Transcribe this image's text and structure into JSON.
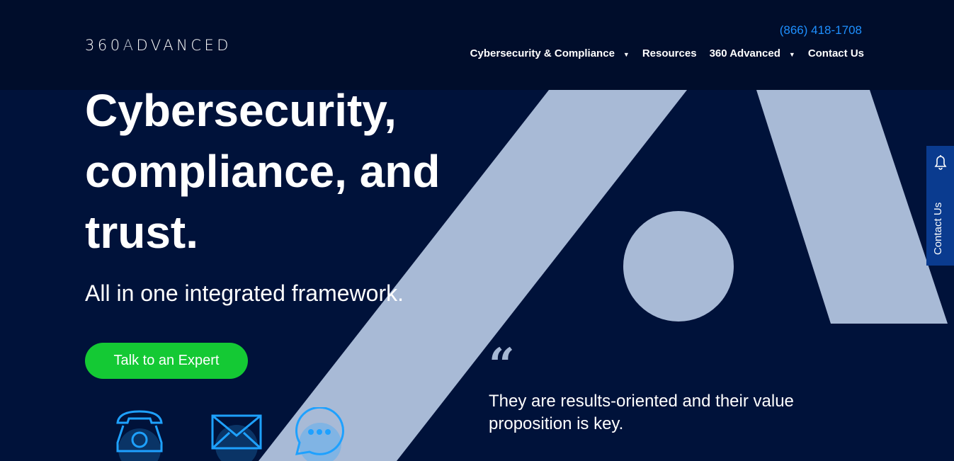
{
  "header": {
    "logo_text": "360ADVANCED",
    "phone": "(866) 418-1708",
    "nav": [
      {
        "label": "Cybersecurity & Compliance",
        "dropdown": true
      },
      {
        "label": "Resources",
        "dropdown": false
      },
      {
        "label": "360 Advanced",
        "dropdown": true
      },
      {
        "label": "Contact Us",
        "dropdown": false
      }
    ]
  },
  "hero": {
    "title": "Cybersecurity, compliance, and trust.",
    "subtitle": "All in one integrated framework.",
    "cta_label": "Talk to an Expert"
  },
  "testimonial": {
    "quote": "They are results-oriented and their value proposition is key."
  },
  "side_tab": {
    "label": "Contact Us",
    "icon": "bell-icon"
  },
  "contact_icons": [
    "phone-icon",
    "mail-icon",
    "chat-icon"
  ],
  "colors": {
    "background": "#00123a",
    "header": "#000d2b",
    "accent_blue": "#1e90ff",
    "cta_green": "#14c934",
    "shape": "#a6b8d4"
  }
}
